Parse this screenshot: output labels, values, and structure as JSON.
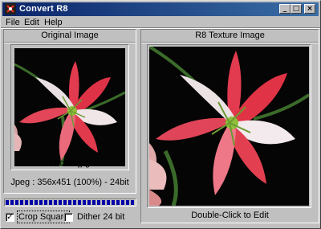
{
  "window": {
    "title": "Convert R8",
    "minimize_glyph": "_",
    "maximize_glyph": "□",
    "close_glyph": "×"
  },
  "menu": [
    "File",
    "Edit",
    "Help"
  ],
  "left_panel": {
    "title": "Original Image",
    "filename": "Orchid.jpg",
    "info": "Jpeg : 356x451 (100%) - 24bit"
  },
  "right_panel": {
    "title": "R8 Texture Image",
    "hint": "Double-Click to Edit"
  },
  "progress": {
    "value_percent": 100,
    "color": "#0000a8"
  },
  "options": {
    "crop_square": {
      "label": "Crop Square",
      "checked": true,
      "check_glyph": "✓"
    },
    "dither_24bit": {
      "label": "Dither 24 bit",
      "checked": false,
      "check_glyph": ""
    }
  },
  "colors": {
    "titlebar_start": "#0a246a",
    "titlebar_end": "#3a6ea5",
    "face": "#c0c0c0"
  },
  "icons": [
    "convert-app-icon",
    "minimize-icon",
    "maximize-icon",
    "close-icon",
    "lily-image"
  ]
}
